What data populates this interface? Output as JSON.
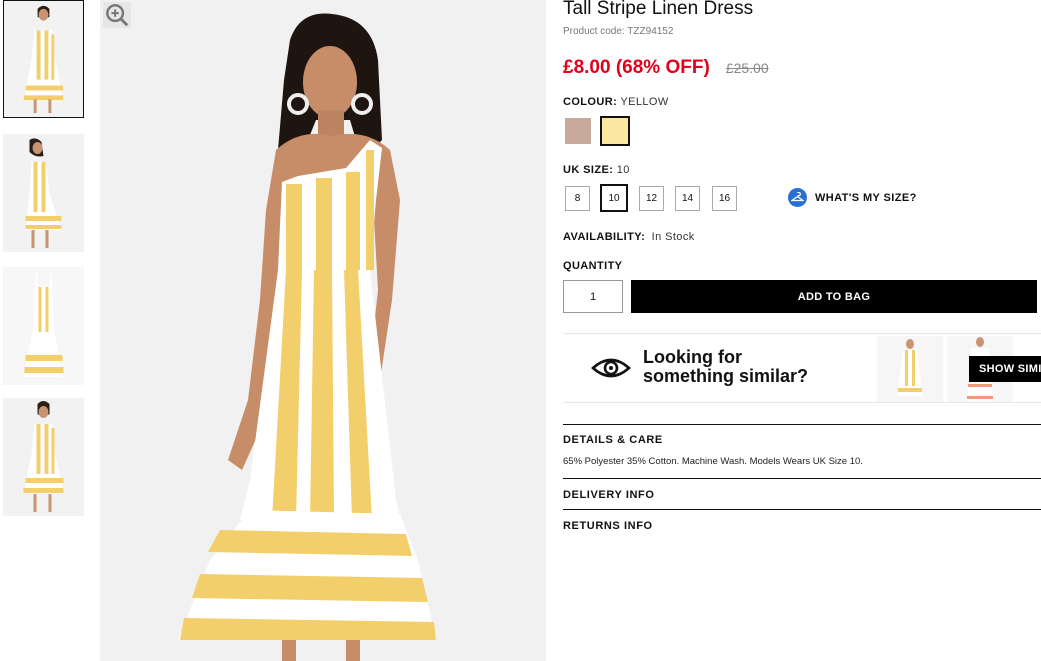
{
  "thumbnails": [
    {
      "alt": "Tall Stripe Linen Dress front view",
      "active": true
    },
    {
      "alt": "Tall Stripe Linen Dress side view",
      "active": false
    },
    {
      "alt": "Tall Stripe Linen Dress flat lay",
      "active": false
    },
    {
      "alt": "Tall Stripe Linen Dress full length",
      "active": false
    }
  ],
  "product": {
    "title": "Tall Stripe Linen Dress",
    "code": "Product code: TZZ94152",
    "price_sale": "£8.00 (68% OFF)",
    "price_old": "£25.00"
  },
  "colour": {
    "label": "COLOUR:",
    "value": "YELLOW",
    "swatches": [
      {
        "name": "Stone",
        "hex": "#c6a99a",
        "selected": false
      },
      {
        "name": "Yellow",
        "hex": "#fbe7a0",
        "selected": true
      }
    ]
  },
  "size": {
    "label": "UK SIZE:",
    "value": "10",
    "options": [
      "8",
      "10",
      "12",
      "14",
      "16"
    ],
    "selected": "10",
    "guide_label": "WHAT'S MY SIZE?"
  },
  "availability": {
    "label": "AVAILABILITY:",
    "value": "In Stock"
  },
  "quantity": {
    "label": "QUANTITY",
    "value": "1"
  },
  "add_to_bag_label": "ADD TO BAG",
  "similar": {
    "line1": "Looking for",
    "line2": "something similar?",
    "button_label": "SHOW SIMILAR"
  },
  "accordion": {
    "details_title": "DETAILS & CARE",
    "details_body": "65% Polyester 35% Cotton. Machine Wash. Models Wears UK Size 10.",
    "delivery_title": "DELIVERY INFO",
    "returns_title": "RETURNS INFO"
  },
  "colors": {
    "sale_red": "#e4001b",
    "stripe_yellow": "#f2cf6a",
    "button_black": "#000000",
    "size_guide_blue": "#2b6fd6"
  }
}
